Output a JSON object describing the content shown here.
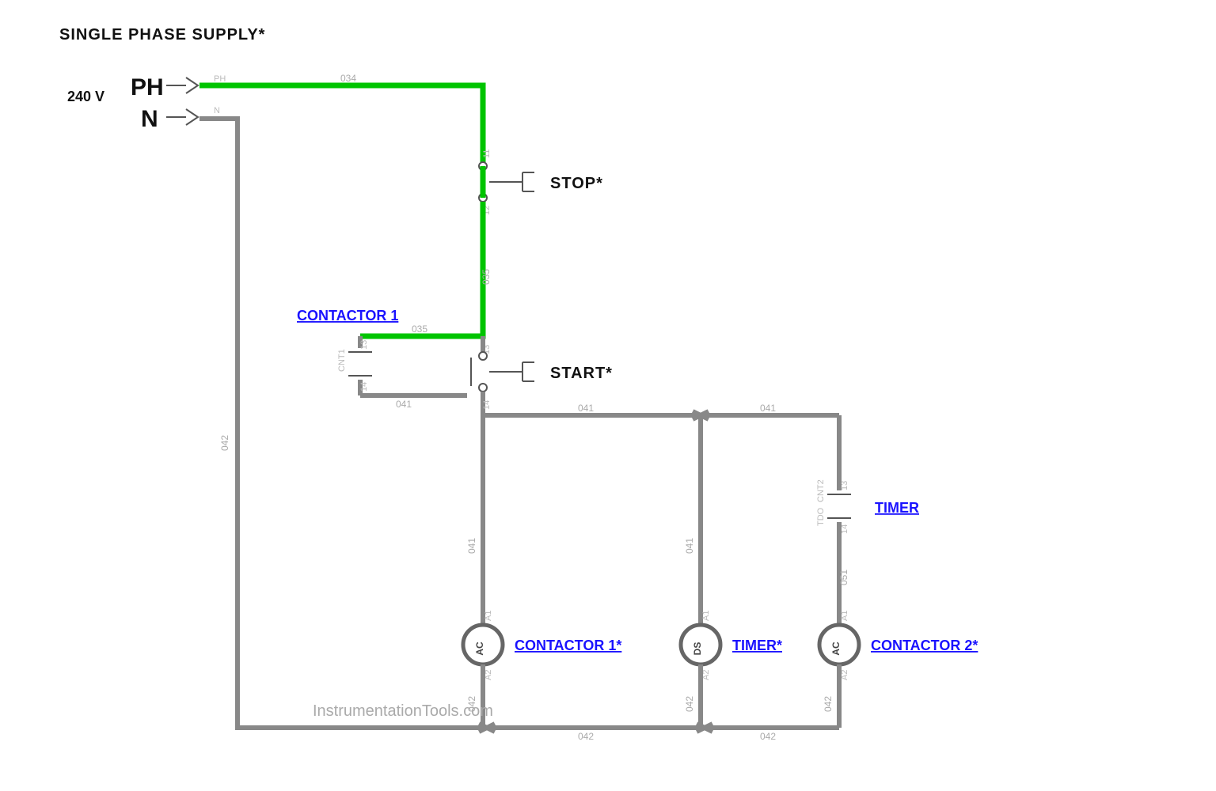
{
  "title": "SINGLE PHASE SUPPLY*",
  "voltage": "240 V",
  "phase_symbol": "PH",
  "neutral_symbol": "N",
  "stop_label": "STOP*",
  "start_label": "START*",
  "contactor1_aux_label": "CONTACTOR 1",
  "coil1_label": "CONTACTOR 1*",
  "timer_coil_label": "TIMER*",
  "timer_contact_label": "TIMER",
  "coil2_label": "CONTACTOR 2*",
  "watermark": "InstrumentationTools.com",
  "net": {
    "ph": "PH",
    "n": "N",
    "w034": "034",
    "w035": "035",
    "w041": "041",
    "w042": "042",
    "w051": "051",
    "t11": "11",
    "t12": "12",
    "t13": "13",
    "t14": "14",
    "a1": "A1",
    "a2": "A2",
    "cnt1": "CNT1",
    "tdo": "TDO",
    "cnt2": "CNT2"
  },
  "coil_text": {
    "ac": "AC",
    "ds": "DS"
  }
}
